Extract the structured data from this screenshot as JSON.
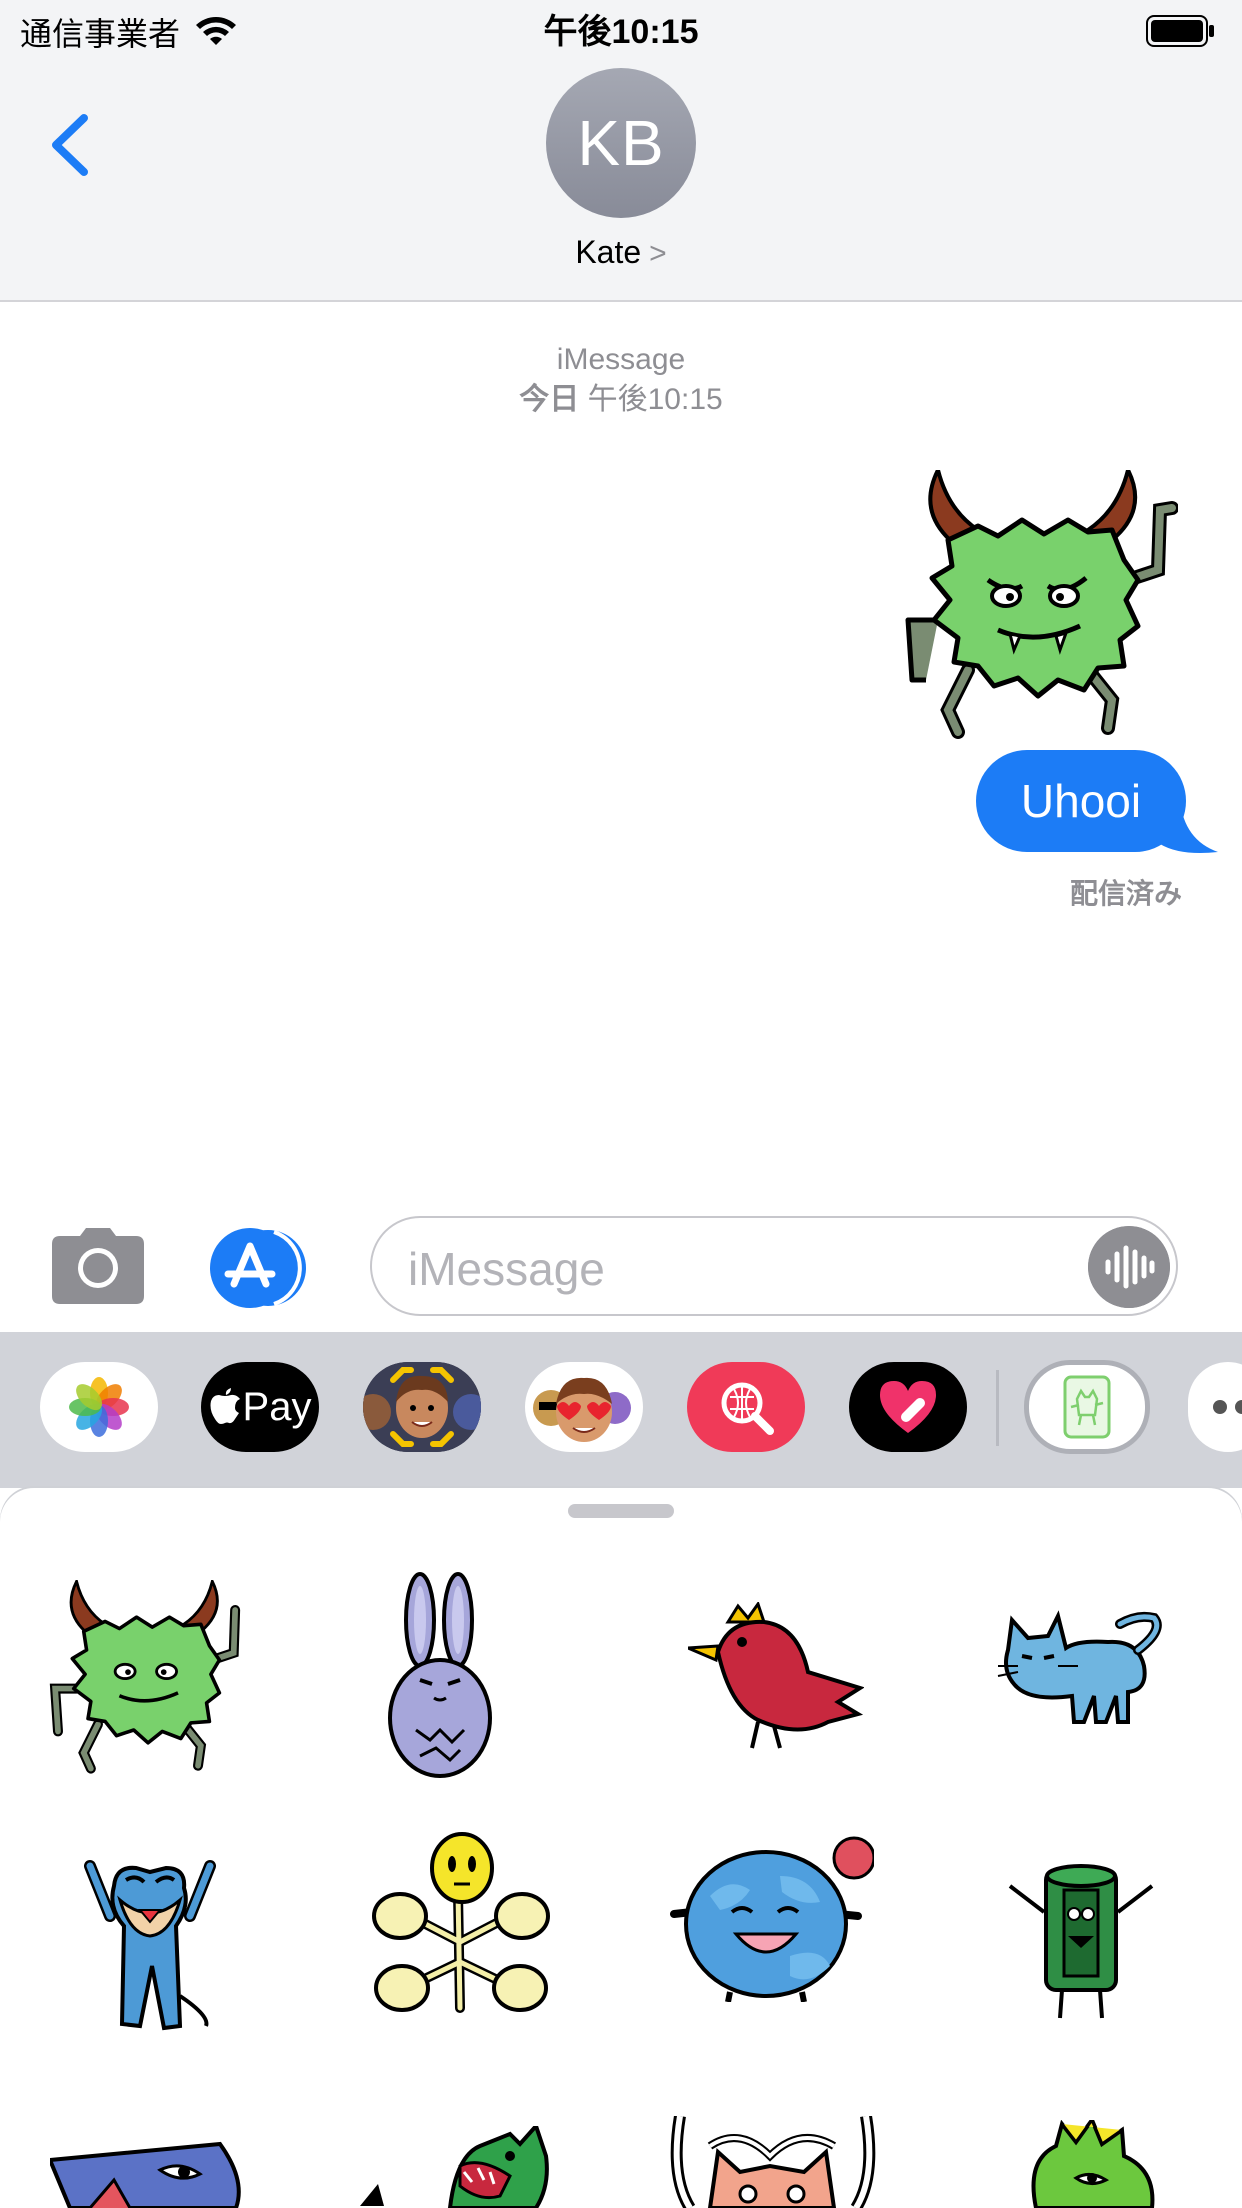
{
  "status_bar": {
    "carrier": "通信事業者",
    "time": "午後10:15"
  },
  "header": {
    "avatar_initials": "KB",
    "contact_name": "Kate",
    "contact_chevron": ">"
  },
  "conversation": {
    "service_label": "iMessage",
    "timestamp_bold": "今日",
    "timestamp_time": "午後10:15",
    "message_text": "Uhooi",
    "delivery_status": "配信済み"
  },
  "input_bar": {
    "placeholder": "iMessage"
  },
  "app_drawer": {
    "apple_pay_label": "Pay",
    "apps": [
      "photos-icon",
      "apple-pay-icon",
      "memoji-icon",
      "animoji-stickers-icon",
      "images-search-icon",
      "digital-touch-icon",
      "uhooi-stickers-icon",
      "more-apps-icon"
    ]
  },
  "sticker_panel": {
    "stickers": [
      "green-monster",
      "lavender-rabbit",
      "red-bird",
      "blue-cat",
      "blue-creature",
      "yellow-flower",
      "earth-character",
      "green-can-character",
      "blue-shark",
      "green-dragon",
      "horned-cat-character",
      "green-dinosaur"
    ]
  },
  "colors": {
    "accent": "#1C7CF6",
    "bubble_text": "#FFFFFF",
    "secondary_text": "#8E8E93"
  }
}
